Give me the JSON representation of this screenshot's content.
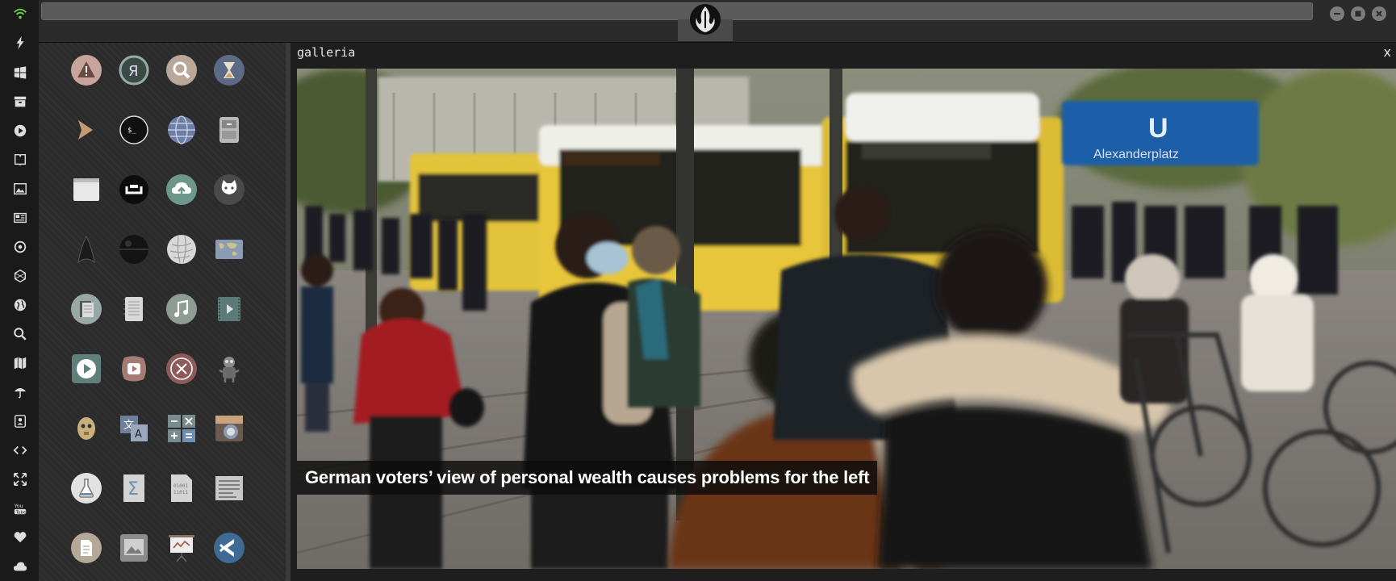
{
  "gallery": {
    "title": "galleria",
    "close_glyph": "x",
    "caption": "German voters’ view of personal wealth causes problems for the left"
  },
  "photo": {
    "sign_letter": "U",
    "sign_text": "Alexanderplatz"
  },
  "dock": {
    "items": [
      "wifi-icon",
      "lightning-icon",
      "windows-icon",
      "archive-icon",
      "play-icon",
      "book-icon",
      "image-icon",
      "newspaper-icon",
      "settings-icon",
      "hexagon-icon",
      "globe-icon",
      "search-icon",
      "map-icon",
      "umbrella-icon",
      "contacts-icon",
      "code-icon",
      "expand-icon",
      "youtube-icon",
      "heart-icon",
      "cloud-icon"
    ]
  },
  "grid": {
    "icons": [
      "warning-icon",
      "yandex-icon",
      "search-icon",
      "hourglass-icon",
      "chevron-right-icon",
      "terminal-icon",
      "globe-icon",
      "file-cabinet-icon",
      "window-icon",
      "webcam-icon",
      "cloud-upload-icon",
      "github-icon",
      "starfleet-icon",
      "death-star-icon",
      "wikipedia-icon",
      "world-map-icon",
      "document-stack-icon",
      "notepad-icon",
      "music-icon",
      "video-file-icon",
      "play-button-icon",
      "video-player-icon",
      "close-circle-icon",
      "robot-icon",
      "c3po-icon",
      "translate-icon",
      "calculator-icon",
      "camera-icon",
      "flask-icon",
      "sigma-icon",
      "binary-file-icon",
      "text-lines-icon",
      "document-icon",
      "picture-icon",
      "presentation-icon",
      "vscode-icon"
    ]
  },
  "colors": {
    "accent_green": "#6fd64a",
    "panel": "#2b2b2b",
    "caption_bg": "#0c0c0c"
  }
}
